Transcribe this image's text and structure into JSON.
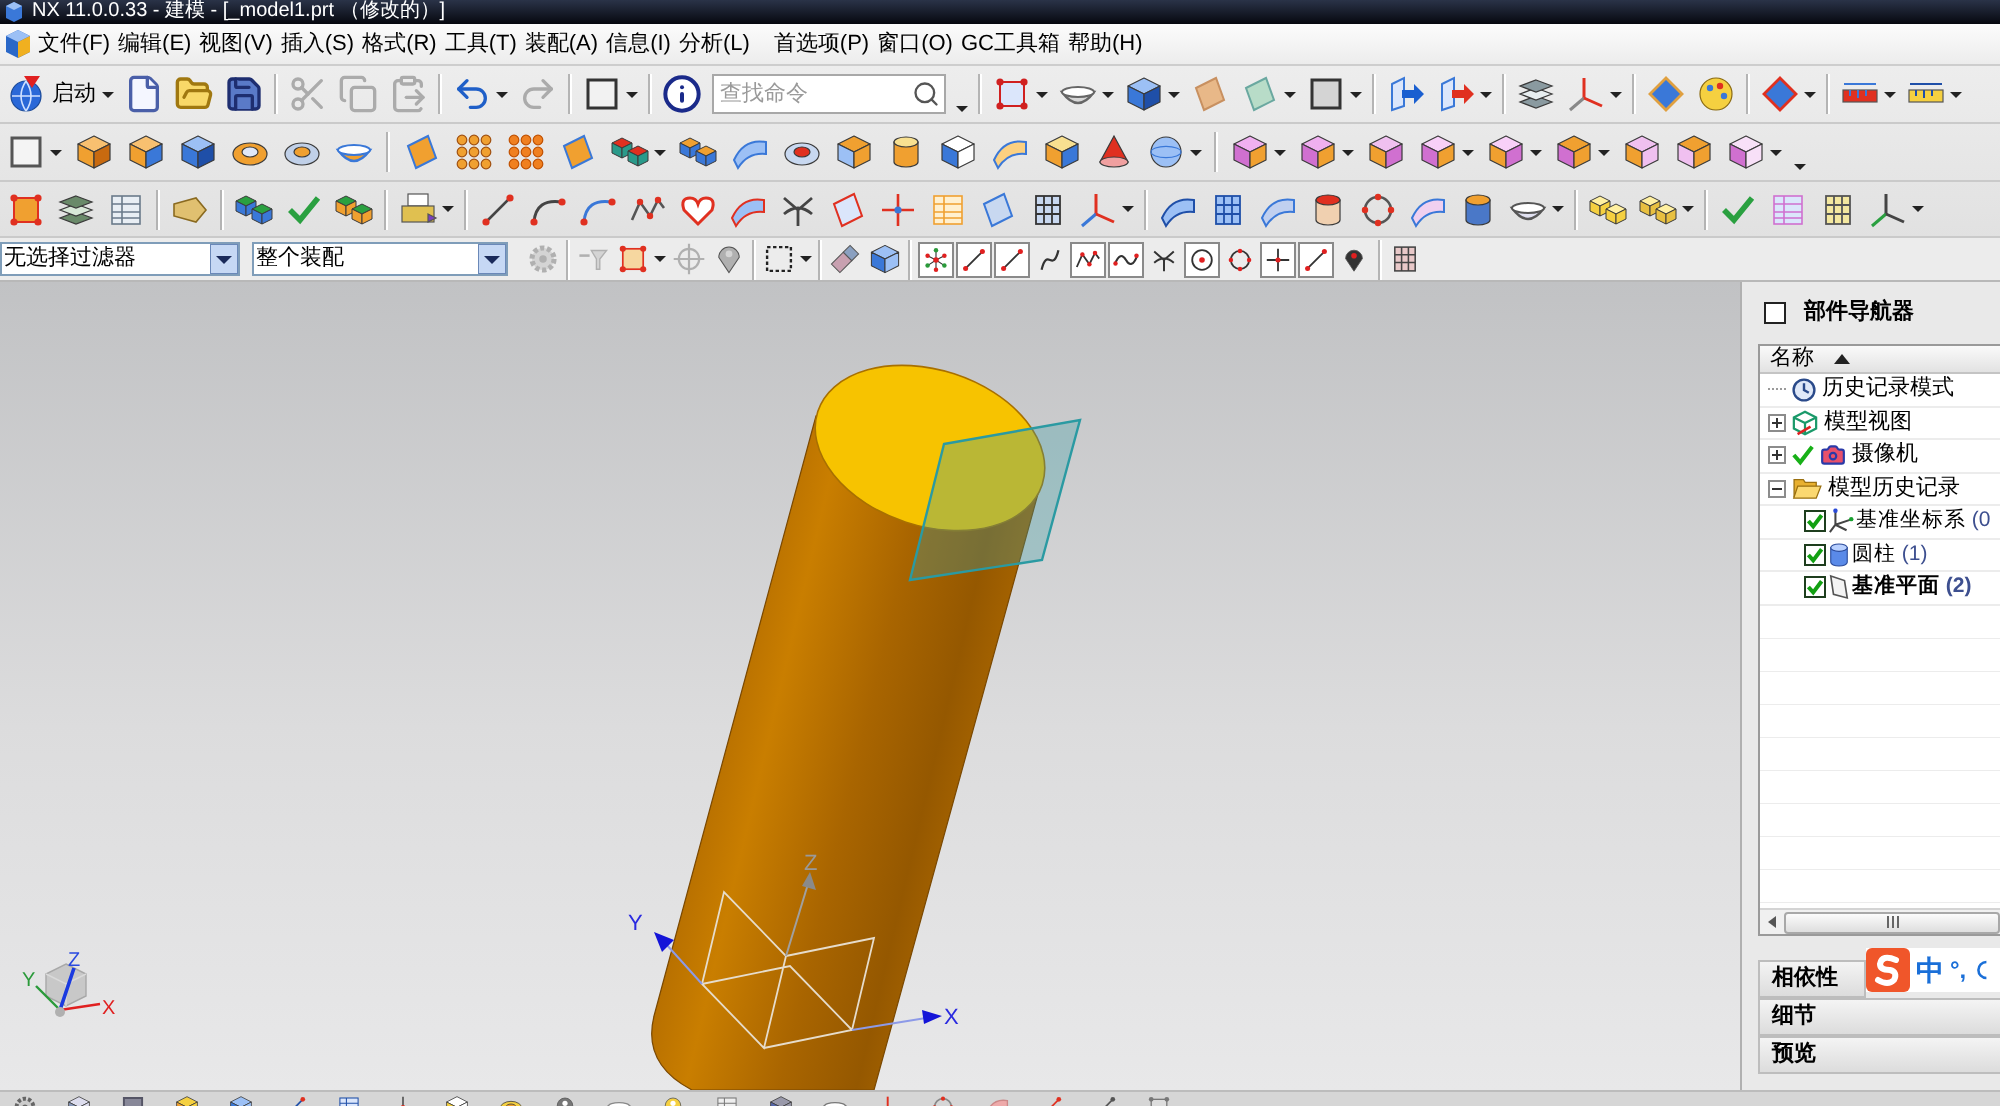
{
  "window": {
    "title": "NX 11.0.0.33 - 建模 - [_model1.prt （修改的）]"
  },
  "menu_bar": [
    "文件(F)",
    "编辑(E)",
    "视图(V)",
    "插入(S)",
    "格式(R)",
    "工具(T)",
    "装配(A)",
    "信息(I)",
    "分析(L)",
    "首选项(P)",
    "窗口(O)",
    "GC工具箱",
    "帮助(H)"
  ],
  "standard_toolbar": {
    "start": "启动",
    "commands": [
      {
        "kind": "new",
        "disabled": false,
        "menu": false
      },
      {
        "kind": "open",
        "disabled": false,
        "menu": false
      },
      {
        "kind": "save",
        "disabled": false,
        "menu": false
      },
      {
        "kind": "cut",
        "disabled": true,
        "menu": false
      },
      {
        "kind": "copy",
        "disabled": true,
        "menu": false
      },
      {
        "kind": "paste",
        "disabled": true,
        "menu": false
      },
      {
        "kind": "undo",
        "disabled": false,
        "menu": true
      },
      {
        "kind": "redo",
        "disabled": true,
        "menu": false
      }
    ],
    "search": {
      "placeholder": "查找命令"
    }
  },
  "selection_bar": {
    "filter": "无选择过滤器",
    "scope": "整个装配",
    "tools": [
      {
        "kind": "gear",
        "disabled": true,
        "menu": false
      },
      {
        "kind": "funnel",
        "disabled": true,
        "menu": false
      },
      {
        "kind": "frame",
        "disabled": false,
        "menu": true
      },
      {
        "kind": "target",
        "disabled": true,
        "menu": false
      },
      {
        "kind": "pin",
        "disabled": true,
        "menu": false
      },
      {
        "kind": "dashsq",
        "disabled": false,
        "menu": true
      },
      {
        "kind": "eraser",
        "disabled": false,
        "menu": false
      },
      {
        "kind": "cube",
        "disabled": false,
        "menu": false
      }
    ],
    "snap_points": [
      {
        "kind": "star",
        "on": true
      },
      {
        "kind": "line",
        "on": true
      },
      {
        "kind": "line",
        "on": true
      },
      {
        "kind": "curve",
        "on": false
      },
      {
        "kind": "poly",
        "on": true
      },
      {
        "kind": "wave",
        "on": true
      },
      {
        "kind": "junction",
        "on": false
      },
      {
        "kind": "cdot",
        "on": true
      },
      {
        "kind": "ring",
        "on": false
      },
      {
        "kind": "cross",
        "on": true
      },
      {
        "kind": "line",
        "on": true
      },
      {
        "kind": "pin",
        "on": false
      }
    ]
  },
  "viewport": {
    "csys_axes": {
      "x": "X",
      "y": "Y",
      "z": "Z"
    },
    "view_triad": {
      "x": "X",
      "y": "Y",
      "z": "Z"
    }
  },
  "part_navigator": {
    "title": "部件导航器",
    "column": "名称",
    "nodes": [
      {
        "kind": "mode",
        "label": "历史记录模式"
      },
      {
        "kind": "views",
        "label": "模型视图",
        "expanded": false
      },
      {
        "kind": "cameras",
        "label": "摄像机",
        "expanded": false
      },
      {
        "kind": "history",
        "label": "模型历史记录",
        "expanded": true,
        "children": [
          {
            "kind": "csys",
            "label": "基准坐标系",
            "count": "(0",
            "checked": true,
            "current": false
          },
          {
            "kind": "cylinder",
            "label": "圆柱",
            "count": "(1)",
            "checked": true,
            "current": false
          },
          {
            "kind": "plane",
            "label": "基准平面",
            "count": "(2)",
            "checked": true,
            "current": true
          }
        ]
      }
    ],
    "panels": [
      "相依性",
      "细节",
      "预览"
    ]
  },
  "ime_bar": {
    "mode": "中",
    "punctuation": "°,"
  }
}
